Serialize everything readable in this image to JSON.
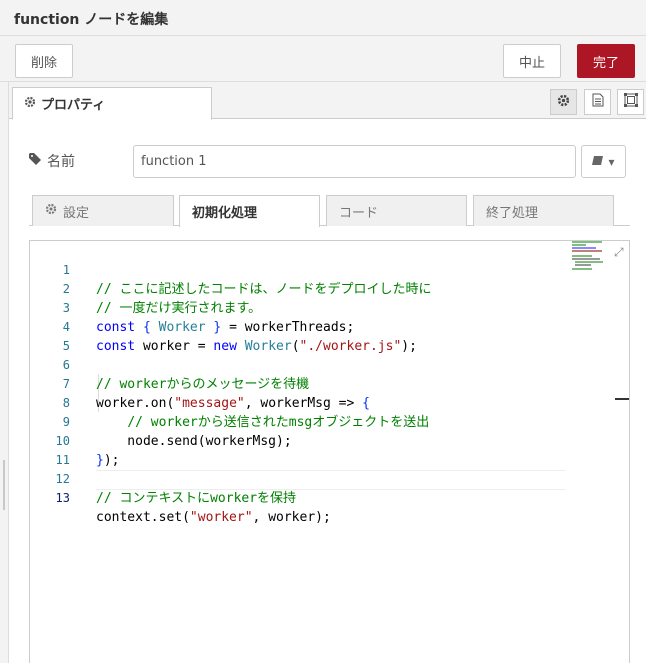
{
  "header": {
    "title": "function ノードを編集"
  },
  "toolbar": {
    "delete_label": "削除",
    "cancel_label": "中止",
    "done_label": "完了"
  },
  "tabs": {
    "properties_label": "プロパティ"
  },
  "form": {
    "name_label": "名前",
    "name_value": "function 1"
  },
  "subtabs": [
    "設定",
    "初期化処理",
    "コード",
    "終了処理"
  ],
  "editor": {
    "line_numbers": [
      "1",
      "2",
      "3",
      "4",
      "5",
      "6",
      "7",
      "8",
      "9",
      "10",
      "11",
      "12",
      "13"
    ]
  },
  "colors": {
    "accent": "#ad1625",
    "comment": "#008000",
    "keyword": "#0000ff",
    "string": "#a31515",
    "type": "#267f99"
  },
  "icons": [
    "gear-icon",
    "tag-icon",
    "book-icon",
    "document-icon",
    "frame-icon",
    "expand-icon"
  ]
}
